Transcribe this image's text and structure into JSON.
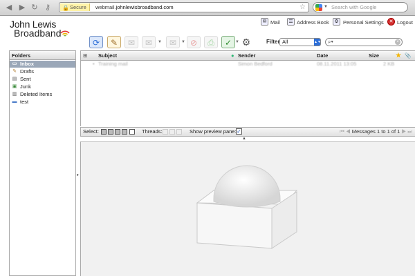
{
  "browser": {
    "back_icon": "back-arrow-icon",
    "forward_icon": "forward-arrow-icon",
    "secure_label": "Secure",
    "url_prefix": "webmail.",
    "url_domain": "johnlewisbroadband.com",
    "search_placeholder": "Search with Google"
  },
  "brand": {
    "line1": "John Lewis",
    "line2": "Broadband",
    "wifi_colors": [
      "#7cb342",
      "#f4b400",
      "#e53935"
    ]
  },
  "header_links": {
    "mail": "Mail",
    "address_book": "Address Book",
    "personal_settings": "Personal Settings",
    "logout": "Logout"
  },
  "toolbar": {
    "filter_label": "Filter:",
    "filter_value": "All",
    "buttons": [
      "check-mail",
      "compose",
      "reply",
      "reply-all",
      "forward",
      "delete",
      "print",
      "mark",
      "settings"
    ]
  },
  "folders": {
    "header": "Folders",
    "items": [
      {
        "label": "Inbox",
        "selected": true,
        "icon": "inbox-icon"
      },
      {
        "label": "Drafts",
        "selected": false,
        "icon": "pencil-icon"
      },
      {
        "label": "Sent",
        "selected": false,
        "icon": "sent-icon"
      },
      {
        "label": "Junk",
        "selected": false,
        "icon": "junk-icon"
      },
      {
        "label": "Deleted Items",
        "selected": false,
        "icon": "trash-icon"
      },
      {
        "label": "test",
        "selected": false,
        "icon": "folder-icon"
      }
    ]
  },
  "message_list": {
    "columns": {
      "subject": "Subject",
      "sender": "Sender",
      "date": "Date",
      "size": "Size"
    },
    "rows": [
      {
        "subject": "Training mail",
        "sender": "Simon Bedford",
        "date": "08.11.2011 13:05",
        "size": "2 KB"
      }
    ]
  },
  "status_bar": {
    "select_label": "Select:",
    "threads_label": "Threads:",
    "preview_label": "Show preview pane:",
    "preview_checked": true,
    "pager_text": "Messages 1 to 1 of 1"
  },
  "colors": {
    "accent_blue": "#2d6fd8",
    "selected_folder": "#9aa7b8",
    "logout_red": "#d32f2f"
  }
}
